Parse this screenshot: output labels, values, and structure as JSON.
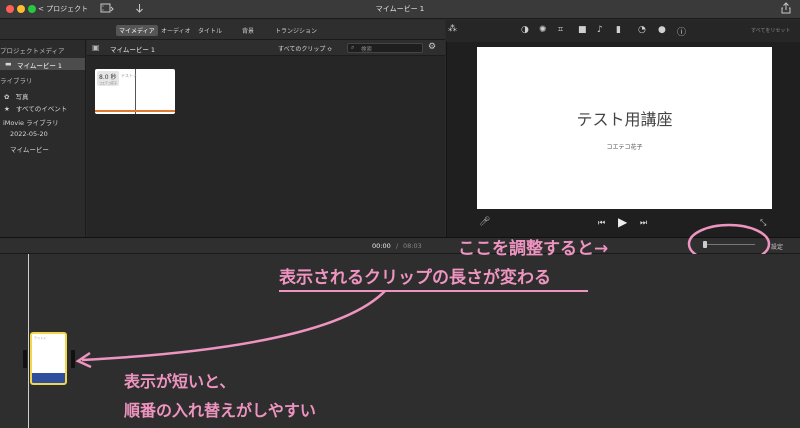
{
  "titlebar": {
    "back_label": "< プロジェクト",
    "title": "マイムービー 1",
    "clip_icon": "film-clip-icon",
    "download_icon": "download-arrow-icon",
    "share_icon": "share-icon"
  },
  "tabs": [
    {
      "label": "マイメディア",
      "active": true
    },
    {
      "label": "オーディオ",
      "active": false
    },
    {
      "label": "タイトル",
      "active": false
    },
    {
      "label": "背景",
      "active": false
    },
    {
      "label": "トランジション",
      "active": false
    }
  ],
  "sidebar": {
    "project_media_header": "プロジェクトメディア",
    "project_item": "マイムービー 1",
    "library_header": "ライブラリ",
    "photos": "写真",
    "all_events": "すべてのイベント",
    "imovie_library": "iMovie ライブラリ",
    "event_date": "2022-05-20",
    "event_name": "マイムービー"
  },
  "browser": {
    "title": "マイムービー 1",
    "filter": "すべてのクリップ ≎",
    "search_placeholder": "検索",
    "clip_duration": "8.0 秒",
    "clip_caption_line1": "テストメ",
    "clip_caption_line2": "コエテコ花子"
  },
  "viewer": {
    "reset_all": "すべてをリセット",
    "preview_title": "テスト用講座",
    "preview_subtitle": "コエテコ花子",
    "icons": [
      "magic-wand-icon",
      "color-balance-icon",
      "color-correction-icon",
      "crop-icon",
      "stabilization-icon",
      "volume-icon",
      "equalizer-icon",
      "speed-icon",
      "noise-reduction-icon",
      "info-icon"
    ]
  },
  "timeline": {
    "current_time": "00:00",
    "separator": "/",
    "total_time": "08:03",
    "settings_label": "設定"
  },
  "annotations": {
    "line1": "ここを調整すると→",
    "line2": "表示されるクリップの長さが変わる",
    "line3": "表示が短いと、",
    "line4": "順番の入れ替えがしやすい"
  },
  "colors": {
    "annotation": "#ee94c0",
    "clip_border": "#f1d54a",
    "audio_bar": "#e07a2e",
    "clip_blue": "#2f4f9e"
  }
}
